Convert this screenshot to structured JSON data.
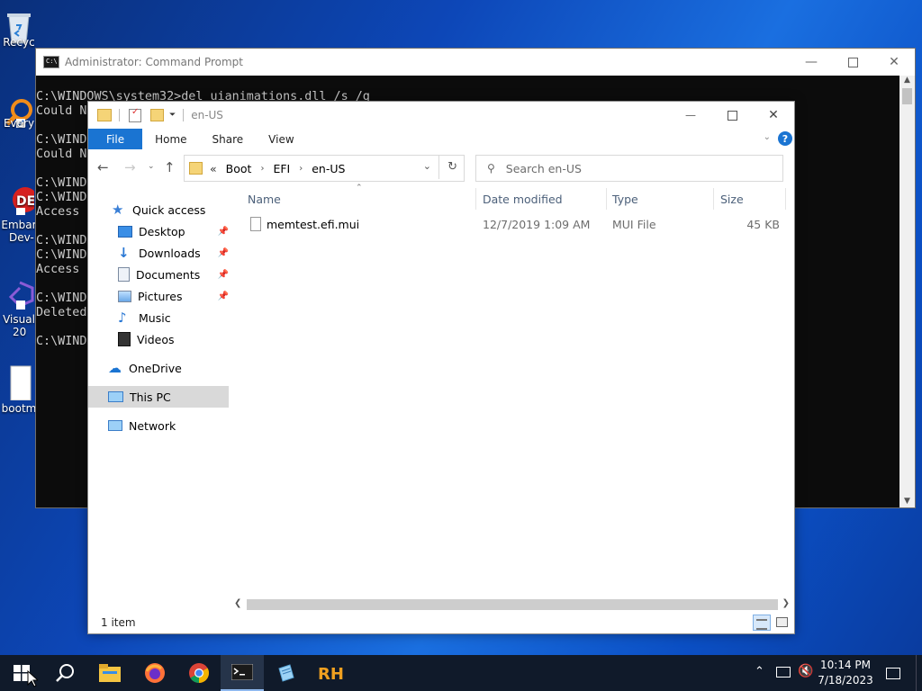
{
  "desktop": {
    "icons": [
      {
        "label": "Recyc"
      },
      {
        "label": "Every"
      },
      {
        "label": "Embar"
      },
      {
        "label": "Dev-"
      },
      {
        "label": "Visual"
      },
      {
        "label": "20"
      },
      {
        "label": "bootm"
      }
    ]
  },
  "cmd": {
    "title": "Administrator: Command Prompt",
    "lines": [
      "C:\\WINDOWS\\system32>del uianimations.dll /s /q",
      "Could No",
      "",
      "C:\\WINDO",
      "Could No",
      "",
      "C:\\WINDO",
      "C:\\WINDO",
      "Access",
      "",
      "C:\\WINDO",
      "C:\\WINDO",
      "Access",
      "",
      "C:\\WINDO",
      "Deleted",
      "",
      "C:\\WINDO"
    ]
  },
  "explorer": {
    "title": "en-US",
    "ribbon": {
      "file": "File",
      "home": "Home",
      "share": "Share",
      "view": "View",
      "help": "?"
    },
    "breadcrumb": {
      "overflow": "«",
      "parts": [
        "Boot",
        "EFI",
        "en-US"
      ]
    },
    "search_placeholder": "Search en-US",
    "nav": {
      "quick_access": "Quick access",
      "pinned": [
        "Desktop",
        "Downloads",
        "Documents",
        "Pictures"
      ],
      "other": [
        "Music",
        "Videos"
      ],
      "onedrive": "OneDrive",
      "this_pc": "This PC",
      "network": "Network"
    },
    "columns": {
      "name": "Name",
      "date": "Date modified",
      "type": "Type",
      "size": "Size"
    },
    "files": [
      {
        "name": "memtest.efi.mui",
        "date": "12/7/2019 1:09 AM",
        "type": "MUI File",
        "size": "45 KB"
      }
    ],
    "status": "1 item"
  },
  "taskbar": {
    "time": "10:14 PM",
    "date": "7/18/2023",
    "pinned": [
      "start",
      "search",
      "file-explorer",
      "firefox",
      "chrome",
      "terminal",
      "notepad",
      "rh"
    ],
    "accent": "#1a74d2"
  }
}
